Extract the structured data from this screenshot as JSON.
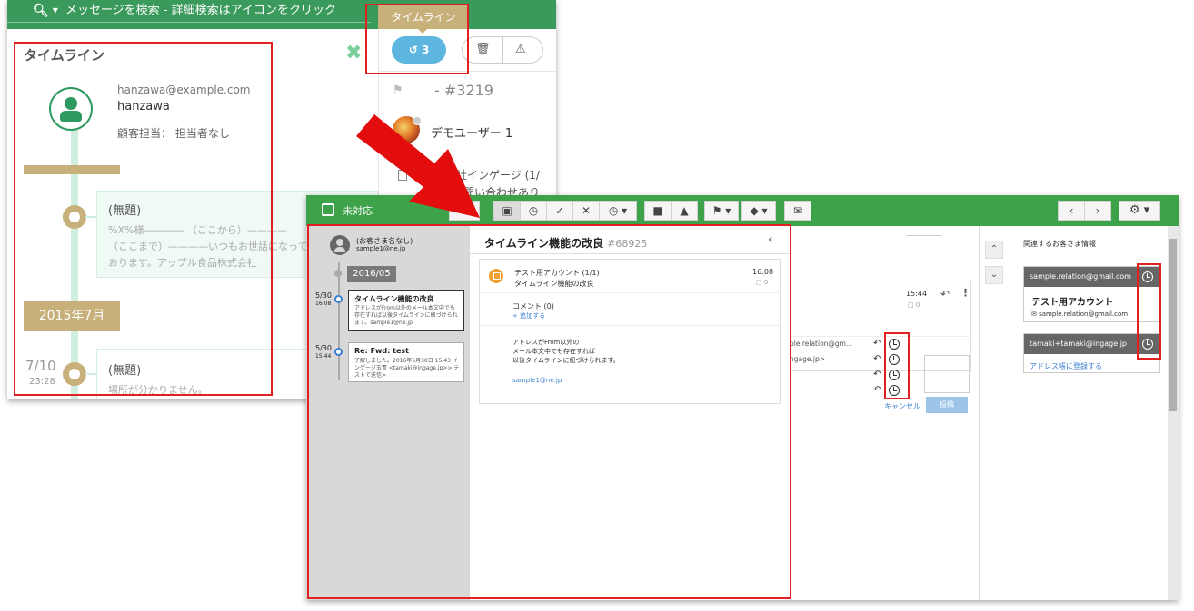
{
  "back_window": {
    "search_placeholder": "メッセージを検索 - 詳細検索はアイコンをクリック",
    "tooltip": "タイムライン",
    "timeline_button_count": "3",
    "ticket": "- #3219",
    "demo_user": "デモユーザー 1",
    "company_text": "会社インゲージ (1/",
    "inquiry_text": "問い合わせあり",
    "timeline": {
      "title": "タイムライン",
      "customer_email": "hanzawa@example.com",
      "customer_name": "hanzawa",
      "owner_label": "顧客担当：",
      "owner_value": "担当者なし",
      "card1_title": "(無題)",
      "card1_body": "%X%様———— （ここから）———— （ここまで）————いつもお世話になっております。アップル食品株式会社",
      "month_label": "2015年7月",
      "item2_date": "7/10",
      "item2_time": "23:28",
      "card2_title": "(無題)",
      "card2_body": "場所が分かりません。"
    }
  },
  "front_window": {
    "status_label": "未対応",
    "timeline": {
      "customer_name": "(お客さま名なし)",
      "customer_email": "sample1@ne.jp",
      "month_label": "2016/05",
      "items": [
        {
          "date": "5/30",
          "time": "16:08",
          "title": "タイムライン機能の改良",
          "body": "アドレスがFrom以外のメール本文中でも存在すれば以後タイムラインに紐づけられます。sample1@ne.jp"
        },
        {
          "date": "5/30",
          "time": "15:44",
          "title": "Re: Fwd: test",
          "body": "了解しました。2016年5月30日 15:43 インゲージ玉青 <tamaki@ingage.jp>> テストで送信>"
        }
      ]
    },
    "detail": {
      "title": "タイムライン機能の改良",
      "number": "#68925",
      "from": "テスト用アカウント (1/1)",
      "subject": "タイムライン機能の改良",
      "time": "16:08",
      "comment_count": "0",
      "comment_label": "コメント (0)",
      "add_comment": "+ 追加する",
      "body_lines": [
        "アドレスがFrom以外の",
        "メール本文中でも存在すれば",
        "以後タイムラインに紐づけられます。"
      ],
      "email_link": "sample1@ne.jp"
    },
    "mid": {
      "time": "15:44",
      "comment_count": "0",
      "addresses": [
        "ple.relation@gm...",
        "ngage.jp>",
        "",
        ""
      ],
      "cancel_label": "キャンセル",
      "post_label": "投稿"
    },
    "related": {
      "title": "関連するお客さま情報",
      "card1_header": "sample.relation@gmail.com",
      "card1_name": "テスト用アカウント",
      "card1_email": "sample.relation@gmail.com",
      "card2_header": "tamaki+tamaki@ingage.jp",
      "card2_link": "アドレス帳に登録する"
    }
  },
  "colors": {
    "accent_green": "#3ea24a",
    "timeline_tan": "#c8b07a",
    "highlight_red": "#e32020",
    "link_blue": "#3b7fd0"
  }
}
